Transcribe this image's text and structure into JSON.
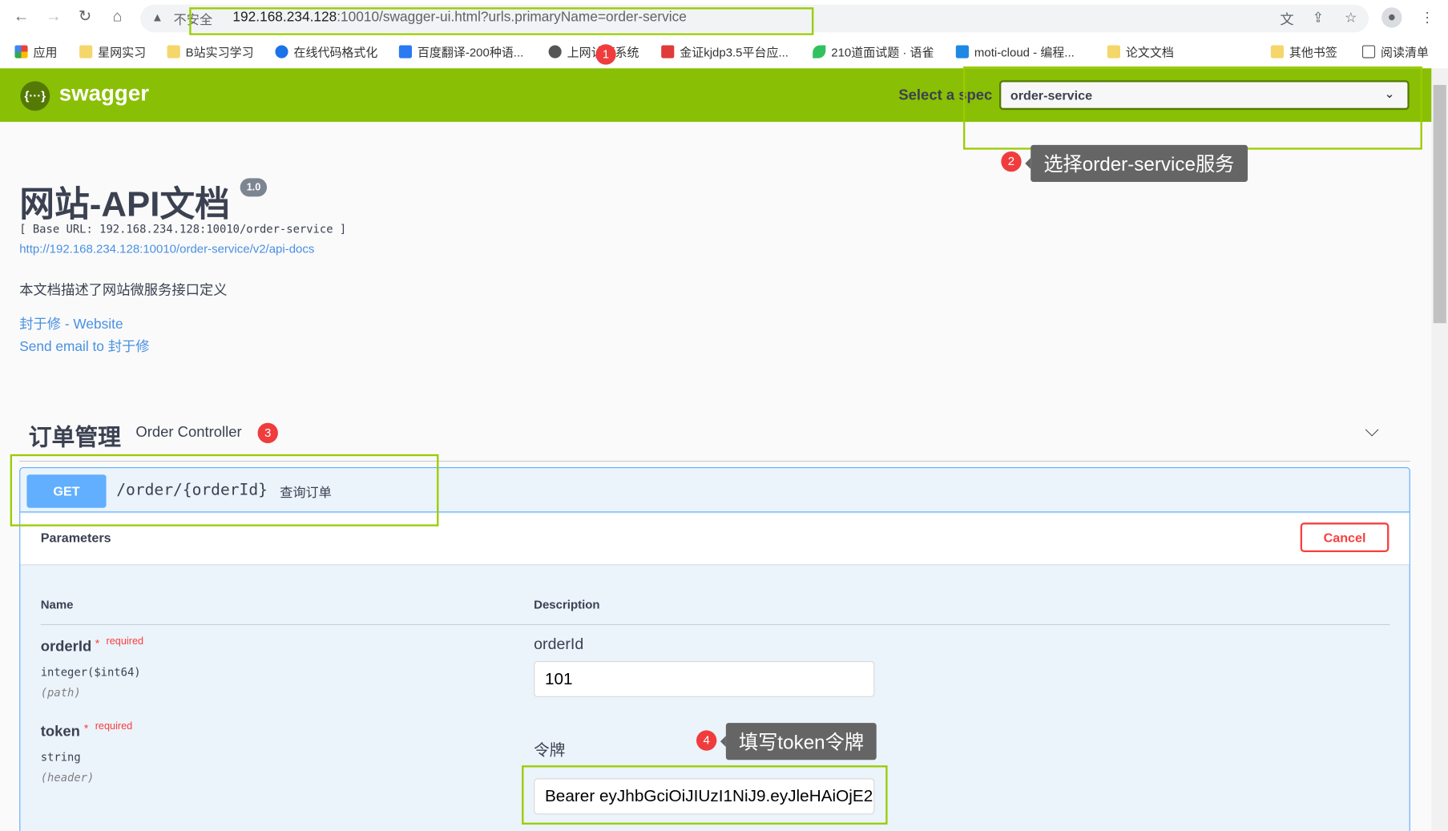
{
  "browser": {
    "address_warning": "不安全",
    "url_host": "192.168.234.128",
    "url_rest": ":10010/swagger-ui.html?urls.primaryName=order-service",
    "bookmarks": [
      {
        "label": "应用",
        "icon": "apps-grid-icon"
      },
      {
        "label": "星网实习",
        "icon": "folder-icon"
      },
      {
        "label": "B站实习学习",
        "icon": "folder-icon"
      },
      {
        "label": "在线代码格式化",
        "icon": "c-logo-icon"
      },
      {
        "label": "百度翻译-200种语...",
        "icon": "translate-icon"
      },
      {
        "label": "上网认证系统",
        "icon": "globe-icon"
      },
      {
        "label": "金证kjdp3.5平台应...",
        "icon": "brand-icon"
      },
      {
        "label": "210道面试题 · 语雀",
        "icon": "yuque-icon"
      },
      {
        "label": "moti-cloud - 编程...",
        "icon": "code-icon"
      },
      {
        "label": "论文文档",
        "icon": "folder-icon"
      },
      {
        "label": "其他书签",
        "icon": "folder-icon"
      },
      {
        "label": "阅读清单",
        "icon": "reading-list-icon"
      }
    ]
  },
  "header": {
    "brand": "swagger",
    "select_label": "Select a spec",
    "selected_spec": "order-service"
  },
  "info": {
    "title": "网站-API文档",
    "version": "1.0",
    "base_url": "[ Base URL: 192.168.234.128:10010/order-service ]",
    "api_docs_link": "http://192.168.234.128:10010/order-service/v2/api-docs",
    "description": "本文档描述了网站微服务接口定义",
    "website_link": "封于修 - Website",
    "email_link": "Send email to 封于修"
  },
  "tag": {
    "name": "订单管理",
    "description": "Order Controller"
  },
  "operation": {
    "method": "GET",
    "path": "/order/{orderId}",
    "summary": "查询订单",
    "parameters_title": "Parameters",
    "cancel_label": "Cancel",
    "col_name": "Name",
    "col_description": "Description",
    "params": [
      {
        "name": "orderId",
        "star": "*",
        "required": "required",
        "type": "integer($int64)",
        "in": "(path)",
        "description": "orderId",
        "value": "101"
      },
      {
        "name": "token",
        "star": "*",
        "required": "required",
        "type": "string",
        "in": "(header)",
        "description": "令牌",
        "value": "Bearer eyJhbGciOiJIUzI1NiJ9.eyJleHAiOjE2"
      }
    ]
  },
  "annotations": [
    {
      "number": "1"
    },
    {
      "number": "2",
      "text": "选择order-service服务"
    },
    {
      "number": "3"
    },
    {
      "number": "4",
      "text": "填写token令牌"
    }
  ],
  "colors": {
    "swagger_green": "#89bf04",
    "get_blue": "#61affe",
    "highlight": "#99cc00",
    "annotation_red": "#f03c3c"
  }
}
